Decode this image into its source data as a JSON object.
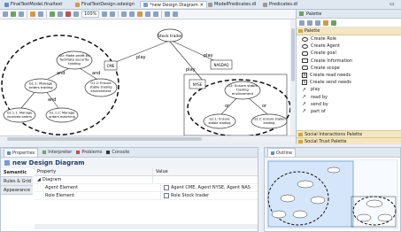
{
  "tabs": [
    {
      "label": "FinalTestModel.finaltest",
      "active": false
    },
    {
      "label": "FinalTestDesign.odesign",
      "active": false
    },
    {
      "label": "*new Design Diagram",
      "active": true
    },
    {
      "label": "ModelPredicates.dl",
      "active": false
    },
    {
      "label": "Predicates.dl",
      "active": false
    }
  ],
  "toolbar": {
    "zoom": "100%"
  },
  "diagram": {
    "nodes": {
      "stock_trader": "Stock trader",
      "nasdaq": "NASDAQ",
      "cme": "CME",
      "nyse": "NYSE",
      "g0": [
        "G0: Make profit by",
        "facilitate security",
        "trading"
      ],
      "g11": [
        "G1.1: Manage",
        "orders trading"
      ],
      "g12": [
        "G1.2: Ensure",
        "stable trading",
        "environment"
      ],
      "g111": [
        "G1.1.1: Manage",
        "received orders"
      ],
      "g112": [
        "G1.1.2: Manage",
        "orders matching"
      ],
      "g2": [
        "G2: Ensure stable",
        "trading",
        "environment"
      ],
      "g21": [
        "G2.1: Ensure",
        "stable trading"
      ],
      "g22": [
        "G2.2: Ensure stable",
        "trading"
      ]
    },
    "edge_labels": {
      "play1": "play",
      "play2": "play",
      "play3": "play",
      "and1": "and",
      "and2": "and",
      "and3": "and",
      "or1": "or",
      "or2": "or"
    }
  },
  "palette": {
    "title": "Palette",
    "drawer": "Palette",
    "items": [
      {
        "label": "Create Role",
        "icon": "oval"
      },
      {
        "label": "Create Agent",
        "icon": "oval"
      },
      {
        "label": "Create goal",
        "icon": "rrect"
      },
      {
        "label": "Create Information",
        "icon": "rect"
      },
      {
        "label": "Create scope",
        "icon": "rrect"
      },
      {
        "label": "Create read needs",
        "icon": "R"
      },
      {
        "label": "Create send needs",
        "icon": "S"
      },
      {
        "label": "play",
        "icon": "arrow"
      },
      {
        "label": "read by",
        "icon": "arrow"
      },
      {
        "label": "send by",
        "icon": "arrow"
      },
      {
        "label": "part of",
        "icon": "arrow"
      }
    ],
    "footer1": "Social Interactions Palette",
    "footer2": "Social Trust Palette"
  },
  "properties": {
    "tabs": [
      "Properties",
      "Interpreter",
      "Problems",
      "Console"
    ],
    "title": "new Design Diagram",
    "categories": [
      "Semantic",
      "Rules & Grid",
      "Appearance"
    ],
    "col_property": "Property",
    "col_value": "Value",
    "rows": [
      {
        "property": "Diagram",
        "value": "",
        "indent": 0
      },
      {
        "property": "Agent Element",
        "value": "Agent CME, Agent NYSE, Agent NAS",
        "indent": 1
      },
      {
        "property": "Role Element",
        "value": "Role Stock trader",
        "indent": 1
      }
    ]
  },
  "outline": {
    "title": "Outline"
  },
  "colors": {
    "accent": "#1f3e6e",
    "drawer": "#f3e6c0",
    "tab_bg": "#dfe7f1"
  }
}
